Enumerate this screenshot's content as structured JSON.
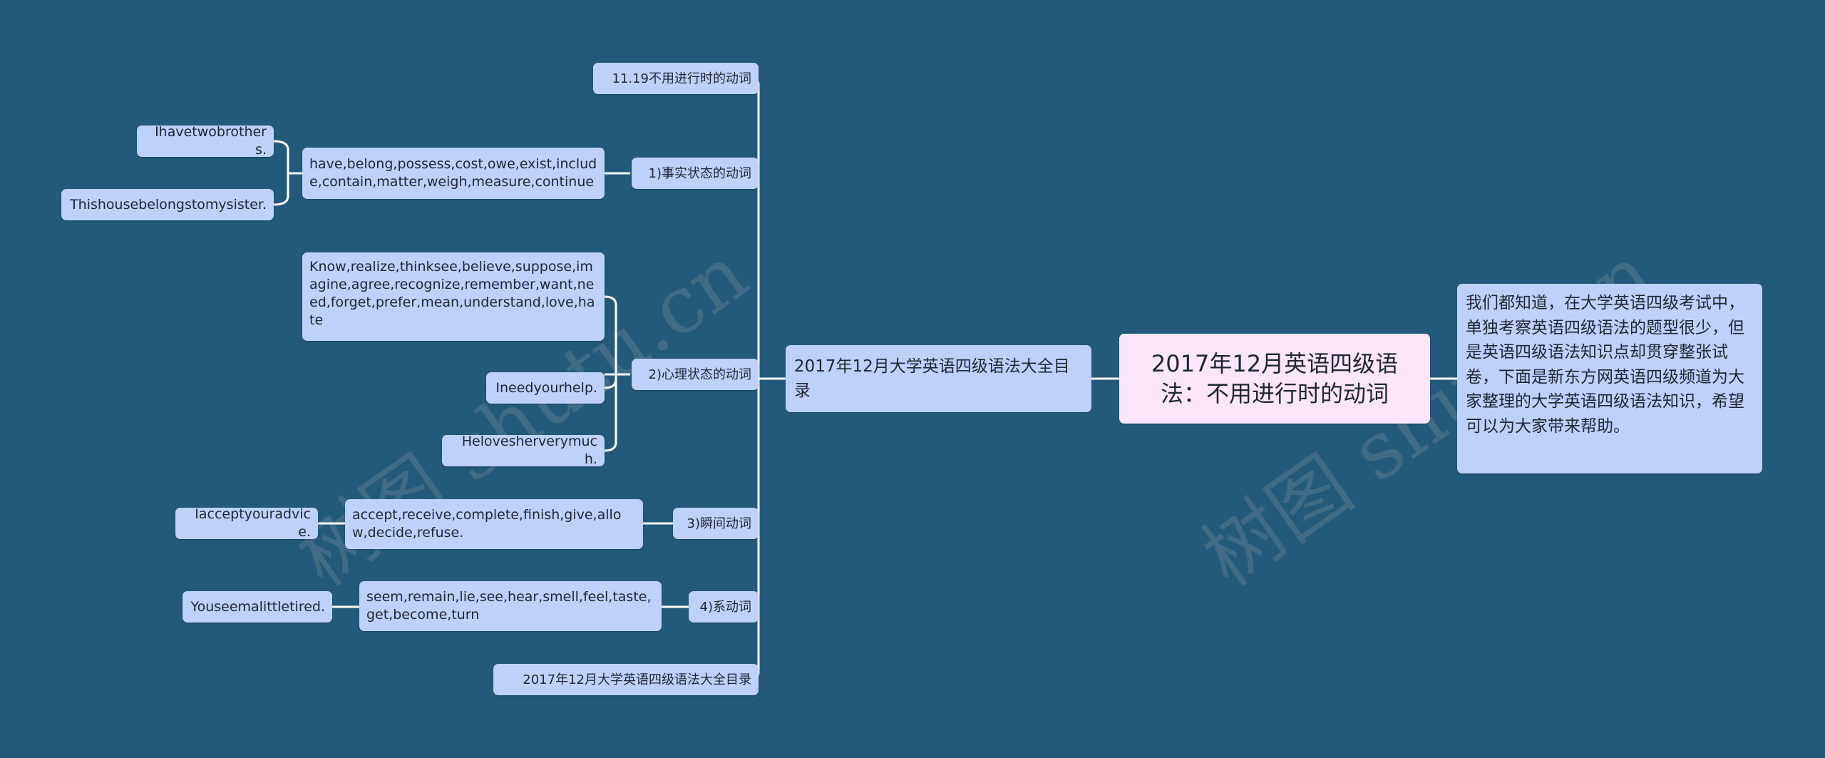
{
  "root": {
    "title": "2017年12月英语四级语法：不用进行时的动词"
  },
  "summary": {
    "text": "我们都知道，在大学英语四级考试中，单独考察英语四级语法的题型很少，但是英语四级语法知识点却贯穿整张试卷，下面是新东方网英语四级频道为大家整理的大学英语四级语法知识，希望可以为大家带来帮助。"
  },
  "main_branch": {
    "label": "2017年12月大学英语四级语法大全目录"
  },
  "topics": [
    {
      "label": "11.19不用进行时的动词"
    },
    {
      "label": "1)事实状态的动词",
      "verbs": "have,belong,possess,cost,owe,exist,include,contain,matter,weigh,measure,continue",
      "examples": [
        "Ihavetwobrothers.",
        "Thishousebelongstomysister."
      ]
    },
    {
      "label": "2)心理状态的动词",
      "verbs": "Know,realize,thinksee,believe,suppose,imagine,agree,recognize,remember,want,need,forget,prefer,mean,understand,love,hate",
      "examples": [
        "Ineedyourhelp.",
        "Helovesherverymuch."
      ]
    },
    {
      "label": "3)瞬间动词",
      "verbs": "accept,receive,complete,finish,give,allow,decide,refuse.",
      "examples": [
        "Iacceptyouradvice."
      ]
    },
    {
      "label": "4)系动词",
      "verbs": "seem,remain,lie,see,hear,smell,feel,taste,get,become,turn",
      "examples": [
        "Youseemalittletired."
      ]
    },
    {
      "label": "2017年12月大学英语四级语法大全目录"
    }
  ],
  "watermark": {
    "text_left": "树图 shutu.cn",
    "text_right": "树图 shutu.cn"
  },
  "colors": {
    "background": "#235a7b",
    "node": "#bdd1fb",
    "root": "#fde6fb",
    "line": "#ffffff"
  }
}
